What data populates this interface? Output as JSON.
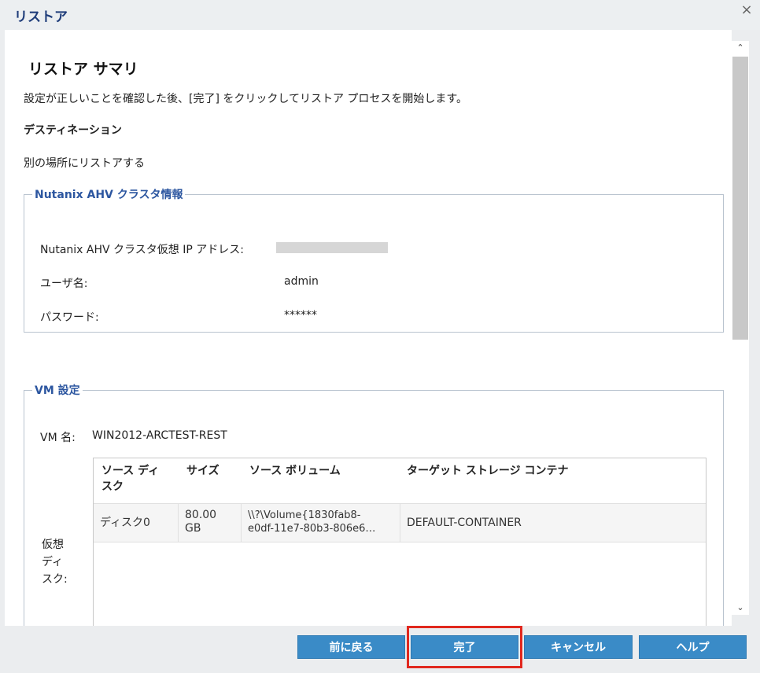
{
  "window": {
    "title": "リストア",
    "close_symbol": "×"
  },
  "summary": {
    "heading": "リストア サマリ",
    "instruction": "設定が正しいことを確認した後、[完了] をクリックしてリストア プロセスを開始します。",
    "destination_label": "デスティネーション",
    "destination_value": "別の場所にリストアする"
  },
  "cluster_info": {
    "legend": "Nutanix AHV クラスタ情報",
    "ip_label": "Nutanix AHV クラスタ仮想 IP アドレス:",
    "ip_value": "",
    "user_label": "ユーザ名:",
    "user_value": "admin",
    "password_label": "パスワード:",
    "password_value": "******"
  },
  "vm_settings": {
    "legend": "VM 設定",
    "vm_name_label": "VM 名:",
    "vm_name_value": "WIN2012-ARCTEST-REST",
    "virtual_disk_label_lines": [
      "仮想",
      "ディ",
      "スク:"
    ],
    "table": {
      "headers": [
        [
          "ソース ディ",
          "スク"
        ],
        [
          "サイズ"
        ],
        [
          "ソース ボリューム"
        ],
        [
          "ターゲット ストレージ コンテナ"
        ]
      ],
      "rows": [
        {
          "source_disk": "ディスク0",
          "size_lines": [
            "80.00",
            "GB"
          ],
          "source_volume_lines": [
            "\\\\?\\Volume{1830fab8-",
            "e0df-11e7-80b3-806e6…"
          ],
          "target_container": "DEFAULT-CONTAINER"
        }
      ]
    }
  },
  "buttons": {
    "back": "前に戻る",
    "finish": "完了",
    "cancel": "キャンセル",
    "help": "ヘルプ"
  },
  "scrollbar": {
    "up_symbol": "⌃",
    "down_symbol": "⌄"
  },
  "colors": {
    "button_bg": "#3a8bc7",
    "legend_text": "#2c56a0",
    "title_text": "#1f3d7a",
    "highlight": "#e1281e"
  }
}
